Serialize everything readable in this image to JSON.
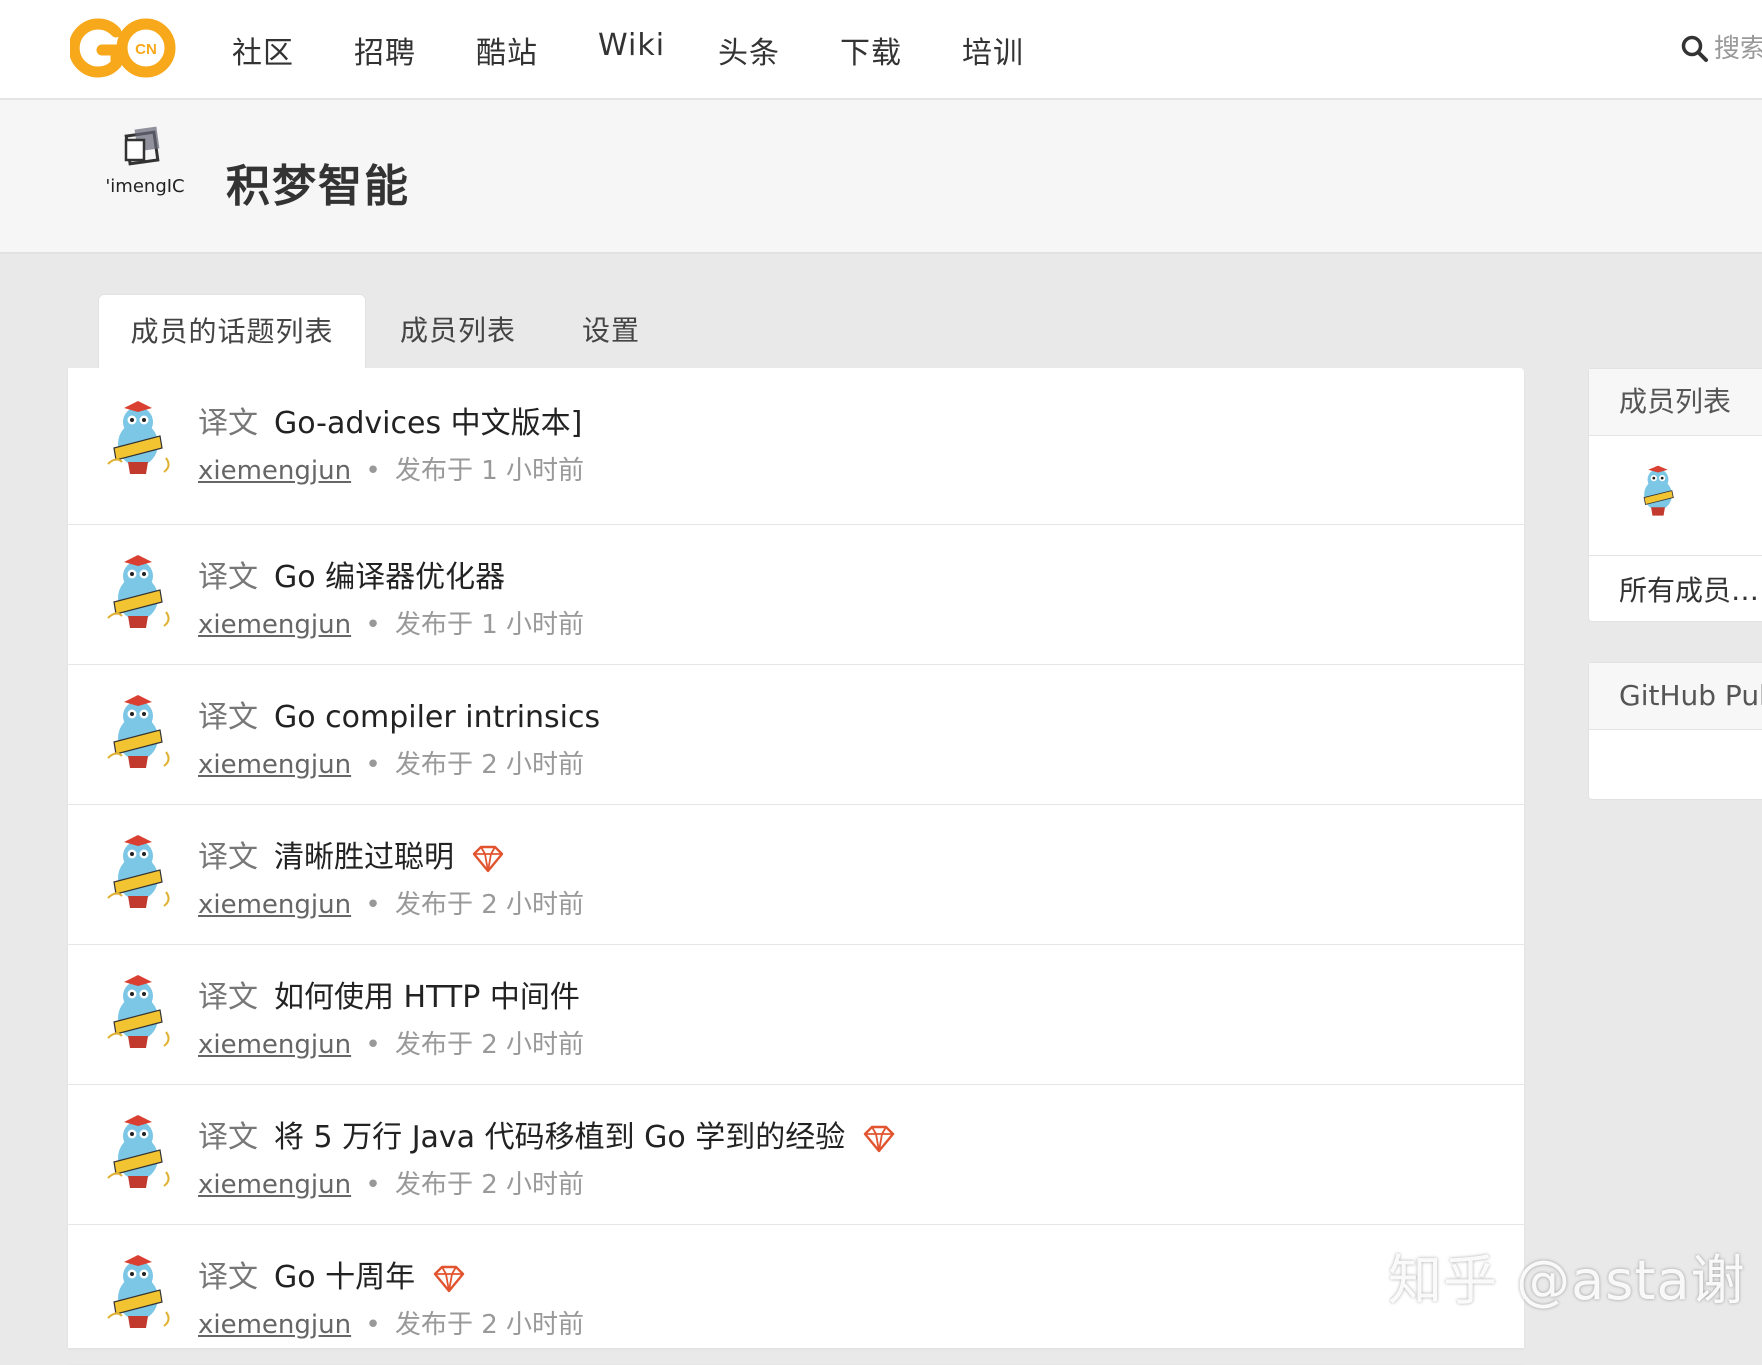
{
  "nav": {
    "logo_text": "CN",
    "items": [
      "社区",
      "招聘",
      "酷站",
      "Wiki",
      "头条",
      "下载",
      "培训"
    ],
    "search_placeholder": "搜索"
  },
  "team": {
    "logo_text": "'imengIC",
    "name": "积梦智能"
  },
  "tabs": [
    {
      "label": "成员的话题列表",
      "active": true
    },
    {
      "label": "成员列表",
      "active": false
    },
    {
      "label": "设置",
      "active": false
    }
  ],
  "topics": [
    {
      "node": "译文",
      "title": "Go-advices 中文版本]",
      "author": "xiemengjun",
      "time": "发布于 1 小时前",
      "gem": false
    },
    {
      "node": "译文",
      "title": "Go 编译器优化器",
      "author": "xiemengjun",
      "time": "发布于 1 小时前",
      "gem": false
    },
    {
      "node": "译文",
      "title": "Go compiler intrinsics",
      "author": "xiemengjun",
      "time": "发布于 2 小时前",
      "gem": false
    },
    {
      "node": "译文",
      "title": "清晰胜过聪明",
      "author": "xiemengjun",
      "time": "发布于 2 小时前",
      "gem": true
    },
    {
      "node": "译文",
      "title": "如何使用 HTTP 中间件",
      "author": "xiemengjun",
      "time": "发布于 2 小时前",
      "gem": false
    },
    {
      "node": "译文",
      "title": "将 5 万行 Java 代码移植到 Go 学到的经验",
      "author": "xiemengjun",
      "time": "发布于 2 小时前",
      "gem": true
    },
    {
      "node": "译文",
      "title": "Go 十周年",
      "author": "xiemengjun",
      "time": "发布于 2 小时前",
      "gem": true
    }
  ],
  "sidebar": {
    "members_title": "成员列表",
    "all_members": "所有成员…",
    "github_title": "GitHub Pub"
  },
  "watermark": "知乎 @asta谢",
  "colors": {
    "logo_orange": "#f7a81b",
    "gem_red": "#e2542f"
  }
}
